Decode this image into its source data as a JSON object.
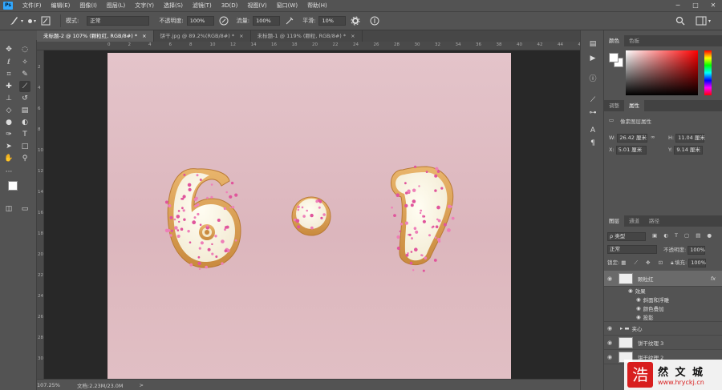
{
  "app": {
    "logo": "Ps"
  },
  "menu": [
    "文件(F)",
    "编辑(E)",
    "图像(I)",
    "图层(L)",
    "文字(Y)",
    "选择(S)",
    "滤镜(T)",
    "3D(D)",
    "视图(V)",
    "窗口(W)",
    "帮助(H)"
  ],
  "window_controls": {
    "minimize": "─",
    "maximize": "□",
    "close": "✕"
  },
  "options": {
    "mode_label": "模式:",
    "mode_value": "正常",
    "opacity_label": "不透明度:",
    "opacity_value": "100%",
    "flow_label": "流量:",
    "flow_value": "100%",
    "smooth_label": "平滑:",
    "smooth_value": "10%"
  },
  "tabs": [
    {
      "label": "未标题-2 @ 107% (颗粒红, RGB/8#) *",
      "close": "×"
    },
    {
      "label": "饼干.jpg @ 89.2%(RGB/8#) *",
      "close": "×"
    },
    {
      "label": "未标题-1 @ 119% (颗粒, RGB/8#) *",
      "close": "×"
    }
  ],
  "ruler": {
    "h_ticks": [
      "0",
      "2",
      "4",
      "6",
      "8",
      "10",
      "12",
      "14",
      "16",
      "18",
      "20",
      "22",
      "24",
      "26",
      "28",
      "30",
      "32",
      "34",
      "36",
      "38",
      "40",
      "42",
      "44",
      "46"
    ],
    "v_ticks": [
      "2",
      "4",
      "6",
      "8",
      "10",
      "12",
      "14",
      "16",
      "18",
      "20",
      "22",
      "24",
      "26",
      "28",
      "30"
    ]
  },
  "status": {
    "zoom": "107.25%",
    "doc": "文档:2.23M/23.0M",
    "arrow": ">"
  },
  "color_panel": {
    "tabs": [
      "颜色",
      "色板"
    ]
  },
  "props_panel": {
    "tabs": [
      "调整",
      "属性"
    ],
    "title": "像素图层属性",
    "w_label": "W:",
    "w_value": "26.42 厘米",
    "h_label": "H:",
    "h_value": "11.04 厘米",
    "x_label": "X:",
    "x_value": "5.01 厘米",
    "y_label": "Y:",
    "y_value": "9.14 厘米",
    "link": "∞"
  },
  "layers_panel": {
    "tabs": [
      "图层",
      "通道",
      "路径"
    ],
    "filter": "ρ 类型",
    "blend": "正常",
    "opacity_label": "不透明度:",
    "opacity_value": "100%",
    "lock_label": "锁定:",
    "fill_label": "填充:",
    "fill_value": "100%",
    "layers": [
      {
        "name": "颗粒红",
        "fx": "fx"
      },
      {
        "name": "效果"
      },
      {
        "name": "斜面和浮雕"
      },
      {
        "name": "颜色叠加"
      },
      {
        "name": "投影"
      },
      {
        "name": "夹心"
      },
      {
        "name": "饼干纹理 3"
      },
      {
        "name": "饼干纹理 2"
      }
    ]
  },
  "watermark": {
    "char": "浩",
    "name": "然 文 城",
    "url": "www.hryckj.cn"
  }
}
